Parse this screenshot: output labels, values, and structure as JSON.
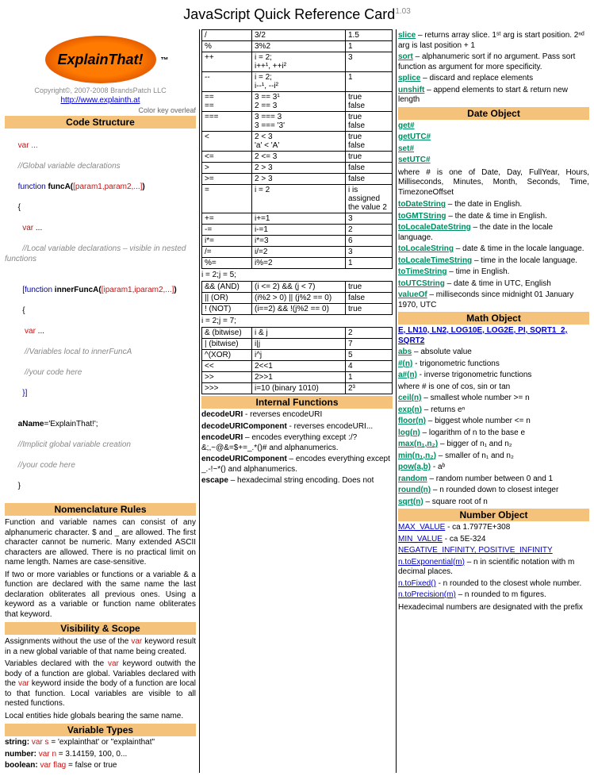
{
  "title": "JavaScript Quick Reference Card",
  "version": "1.03",
  "logo_text": "ExplainThat!",
  "logo_tm": "™",
  "copyright": "Copyright©, 2007-2008 BrandsPatch LLC",
  "site_url": "http://www.explainth.at",
  "color_key": "Color key overleaf",
  "sections": {
    "code_structure": "Code Structure",
    "nomenclature": "Nomenclature Rules",
    "visibility": "Visibility & Scope",
    "vartypes": "Variable Types",
    "internal_fn": "Internal Functions",
    "date_obj": "Date Object",
    "math_obj": "Math Object",
    "number_obj": "Number Object"
  },
  "code": {
    "l1": "var ...",
    "l2": "//Global variable declarations",
    "l3a": "function",
    "l3b": " funcA(",
    "l3c": "[param1,param2,...]",
    "l3d": ")",
    "l4": "{",
    "l5a": "  var",
    "l5b": " ...",
    "l6": "  //Local variable declarations – visible in nested functions",
    "l7a": "  [function",
    "l7b": " innerFuncA(",
    "l7c": "[iparam1,iparam2,...]",
    "l7d": ")",
    "l8": "  {",
    "l9a": "   var",
    "l9b": " ...",
    "l10": "   //Variables local to innerFuncA",
    "l11": "   //your code here",
    "l12": "  }]",
    "l14a": "aName",
    "l14b": "='ExplainThat!';",
    "l15": "//Implicit global variable creation",
    "l16": "//your code here",
    "l17": "}"
  },
  "nomenclature_paras": [
    "Function and variable names can consist of any alphanumeric character. $ and _ are allowed. The first character cannot be numeric. Many extended ASCII characters are allowed. There is no practical limit on name length. Names are case-sensitive.",
    "If two or more variables or functions or a variable & a function are declared with the same name the last declaration obliterates all previous ones. Using a keyword as a variable or function name obliterates that keyword."
  ],
  "visibility_paras": [
    "Assignments without the use of the var keyword result in a new global variable of that name being created.",
    "Variables declared with the var keyword outwith the body of a function are global. Variables declared with the var keyword inside the body of a function are local to that function. Local variables are visible to all nested functions.",
    "Local entities hide globals bearing the same name."
  ],
  "vartypes": {
    "string_lbl": "string: ",
    "string_code": "var s",
    "string_val": " = 'explainthat' or \"explainthat\"",
    "number_lbl": "number: ",
    "number_code": "var n",
    "number_val": " = 3.14159, 100, 0...",
    "bool_lbl": "boolean: ",
    "bool_code": "var flag",
    "bool_val": " = false or true"
  },
  "op_table": [
    {
      "op": "/",
      "ex": "3/2",
      "res": "1.5"
    },
    {
      "op": "%",
      "ex": "3%2",
      "res": "1"
    },
    {
      "op": "++",
      "ex": "i = 2;\ni++¹, ++i²",
      "res": "3"
    },
    {
      "op": "--",
      "ex": "i = 2;\ni--¹, --i²",
      "res": "1"
    },
    {
      "op": "==\n==",
      "ex": "3 == 3¹\n2 == 3",
      "res": "true\nfalse"
    },
    {
      "op": "===",
      "ex": "3 === 3\n3 === '3'",
      "res": "true\nfalse"
    },
    {
      "op": "<",
      "ex": "2 < 3\n'a' < 'A'",
      "res": "true\nfalse"
    },
    {
      "op": "<=",
      "ex": "2 <= 3",
      "res": "true"
    },
    {
      "op": ">",
      "ex": "2 > 3",
      "res": "false"
    },
    {
      "op": ">=",
      "ex": "2 > 3",
      "res": "false"
    },
    {
      "op": "=",
      "ex": "i = 2",
      "res": "i is assigned the value 2"
    },
    {
      "op": "+=",
      "ex": "i+=1",
      "res": "3"
    },
    {
      "op": "-=",
      "ex": "i-=1",
      "res": "2"
    },
    {
      "op": "i*=",
      "ex": "i*=3",
      "res": "6"
    },
    {
      "op": "/=",
      "ex": "i/=2",
      "res": "3"
    },
    {
      "op": "%=",
      "ex": "i%=2",
      "res": "1"
    }
  ],
  "op_caption1": "i = 2;j = 5;",
  "op_table2": [
    {
      "op": "&& (AND)",
      "ex": "(i <= 2) && (j < 7)",
      "res": "true"
    },
    {
      "op": "|| (OR)",
      "ex": "(i%2 > 0) || (j%2 == 0)",
      "res": "false"
    },
    {
      "op": "! (NOT)",
      "ex": "(i==2) && !(j%2 == 0)",
      "res": "true"
    }
  ],
  "op_caption2": "i = 2;j = 7;",
  "op_table3": [
    {
      "op": "& (bitwise)",
      "ex": "i & j",
      "res": "2"
    },
    {
      "op": "| (bitwise)",
      "ex": "i|j",
      "res": "7"
    },
    {
      "op": "^(XOR)",
      "ex": "i^j",
      "res": "5"
    },
    {
      "op": "<<",
      "ex": "2<<1",
      "res": "4"
    },
    {
      "op": ">>",
      "ex": "2>>1",
      "res": "1"
    },
    {
      "op": ">>>",
      "ex": "i=10 (binary 1010)",
      "res": "2³"
    }
  ],
  "internal_fns": [
    {
      "n": "decodeURI",
      "d": " - reverses encodeURI"
    },
    {
      "n": "decodeURIComponent",
      "d": " - reverses encodeURI..."
    },
    {
      "n": "encodeURI",
      "d": " – encodes  everything except :/?&;,~@&=$+=_.*()# and alphanumerics."
    },
    {
      "n": "encodeURIComponent",
      "d": " – encodes everything except _.-!~*() and alphanumerics."
    },
    {
      "n": "escape",
      "d": " – hexadecimal string encoding. Does not"
    }
  ],
  "col3_top": [
    {
      "n": "slice",
      "d": " – returns array slice. 1ˢᵗ arg is start position. 2ⁿᵈ arg is last position + 1"
    },
    {
      "n": "sort",
      "d": " – alphanumeric sort if no argument. Pass sort function as argument for more specificity."
    },
    {
      "n": "splice",
      "d": " – discard and replace elements"
    },
    {
      "n": "unshift",
      "d": " – append elements to start & return new length"
    }
  ],
  "date_items": [
    {
      "n": "get#",
      "d": ""
    },
    {
      "n": "getUTC#",
      "d": ""
    },
    {
      "n": "set#",
      "d": ""
    },
    {
      "n": "setUTC#",
      "d": ""
    }
  ],
  "date_note": "where # is one of Date, Day, FullYear, Hours, Milliseconds, Minutes, Month, Seconds, Time, TimezoneOffset",
  "date_items2": [
    {
      "n": "toDateString",
      "d": " – the date in English."
    },
    {
      "n": "toGMTString",
      "d": " – the date & time in English."
    },
    {
      "n": "toLocaleDateString",
      "d": " – the date in the locale language."
    },
    {
      "n": "toLocaleString",
      "d": " – date & time in the locale language."
    },
    {
      "n": "toLocaleTimeString",
      "d": " – time in the locale language."
    },
    {
      "n": "toTimeString",
      "d": " – time in English."
    },
    {
      "n": "toUTCString",
      "d": " – date & time in UTC, English"
    },
    {
      "n": "valueOf",
      "d": " – milliseconds since midnight 01 January 1970, UTC"
    }
  ],
  "math_consts": "E, LN10, LN2, LOG10E, LOG2E, PI, SQRT1_2, SQRT2",
  "math_items": [
    {
      "n": "abs",
      "d": " – absolute value"
    },
    {
      "n": "#(n)",
      "d": " - trigonometric functions"
    },
    {
      "n": "a#(n)",
      "d": " - inverse trigonometric functions"
    }
  ],
  "math_note": "where # is one of cos, sin or tan",
  "math_items2": [
    {
      "n": "ceil(n)",
      "d": " – smallest whole number >= n"
    },
    {
      "n": "exp(n)",
      "d": " – returns eⁿ"
    },
    {
      "n": "floor(n)",
      "d": " – biggest whole number <= n"
    },
    {
      "n": "log(n)",
      "d": " – logarithm of n to the base e"
    },
    {
      "n": "max(n₁,n₂)",
      "d": " – bigger of n₁ and n₂"
    },
    {
      "n": "min(n₁,n₂)",
      "d": " – smaller of n₁ and n₂"
    },
    {
      "n": "pow(a,b)",
      "d": " - aᵇ"
    },
    {
      "n": "random",
      "d": " – random number between 0 and 1"
    },
    {
      "n": "round(n)",
      "d": " – n rounded down to closest integer"
    },
    {
      "n": "sqrt(n)",
      "d": " – square root of n"
    }
  ],
  "number_items": [
    {
      "n": "MAX_VALUE",
      "d": " - ca 1.7977E+308"
    },
    {
      "n": "MIN_VALUE",
      "d": " - ca 5E-324"
    },
    {
      "n": "NEGATIVE_INFINITY, POSITIVE_INFINITY",
      "d": ""
    },
    {
      "n": "n.toExponential(m)",
      "d": " – n in scientific notation with m decimal places."
    },
    {
      "n": "n.toFixed()",
      "d": " - n rounded to the closest whole number."
    },
    {
      "n": "n.toPrecision(m)",
      "d": " – n rounded to m figures."
    }
  ],
  "number_tail": "Hexadecimal numbers are designated with the prefix"
}
